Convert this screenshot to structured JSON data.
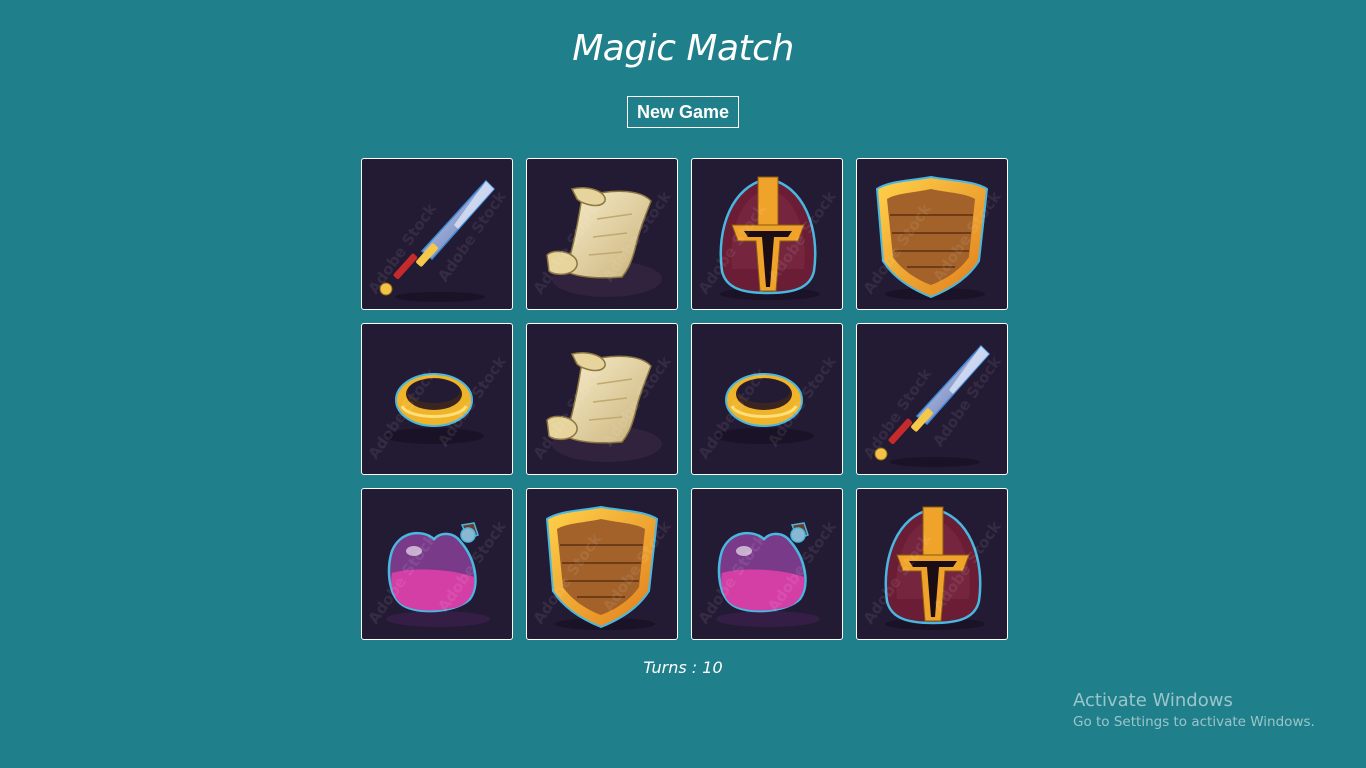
{
  "title": "Magic Match",
  "new_game_label": "New Game",
  "turns": {
    "label": "Turns",
    "separator": " : ",
    "value": "10"
  },
  "cards": [
    {
      "icon": "sword-icon"
    },
    {
      "icon": "scroll-icon"
    },
    {
      "icon": "helmet-icon"
    },
    {
      "icon": "shield-icon"
    },
    {
      "icon": "ring-icon"
    },
    {
      "icon": "scroll-icon"
    },
    {
      "icon": "ring-icon"
    },
    {
      "icon": "sword-icon"
    },
    {
      "icon": "potion-icon"
    },
    {
      "icon": "shield-icon"
    },
    {
      "icon": "potion-icon"
    },
    {
      "icon": "helmet-icon"
    }
  ],
  "watermark": "Adobe Stock",
  "activation": {
    "heading": "Activate Windows",
    "subtext": "Go to Settings to activate Windows."
  },
  "colors": {
    "background": "#1f7f8a",
    "card_back": "#231a33"
  }
}
